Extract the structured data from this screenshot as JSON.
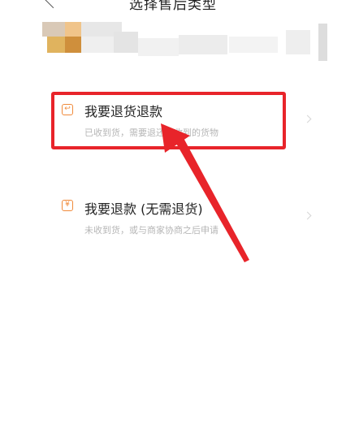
{
  "header": {
    "title": "选择售后类型",
    "back_icon": "chevron-left-icon"
  },
  "product": {
    "thumbnail": "blurred-product-image"
  },
  "options": [
    {
      "label": "我要退货退款",
      "description": "已收到货，需要退还已收到的货物",
      "icon": "return-box-icon"
    },
    {
      "label": "我要退款 (无需退货)",
      "description": "未收到货，或与商家协商之后申请",
      "icon": "yen-refund-icon"
    }
  ],
  "annotation": {
    "color": "#e8242a"
  }
}
